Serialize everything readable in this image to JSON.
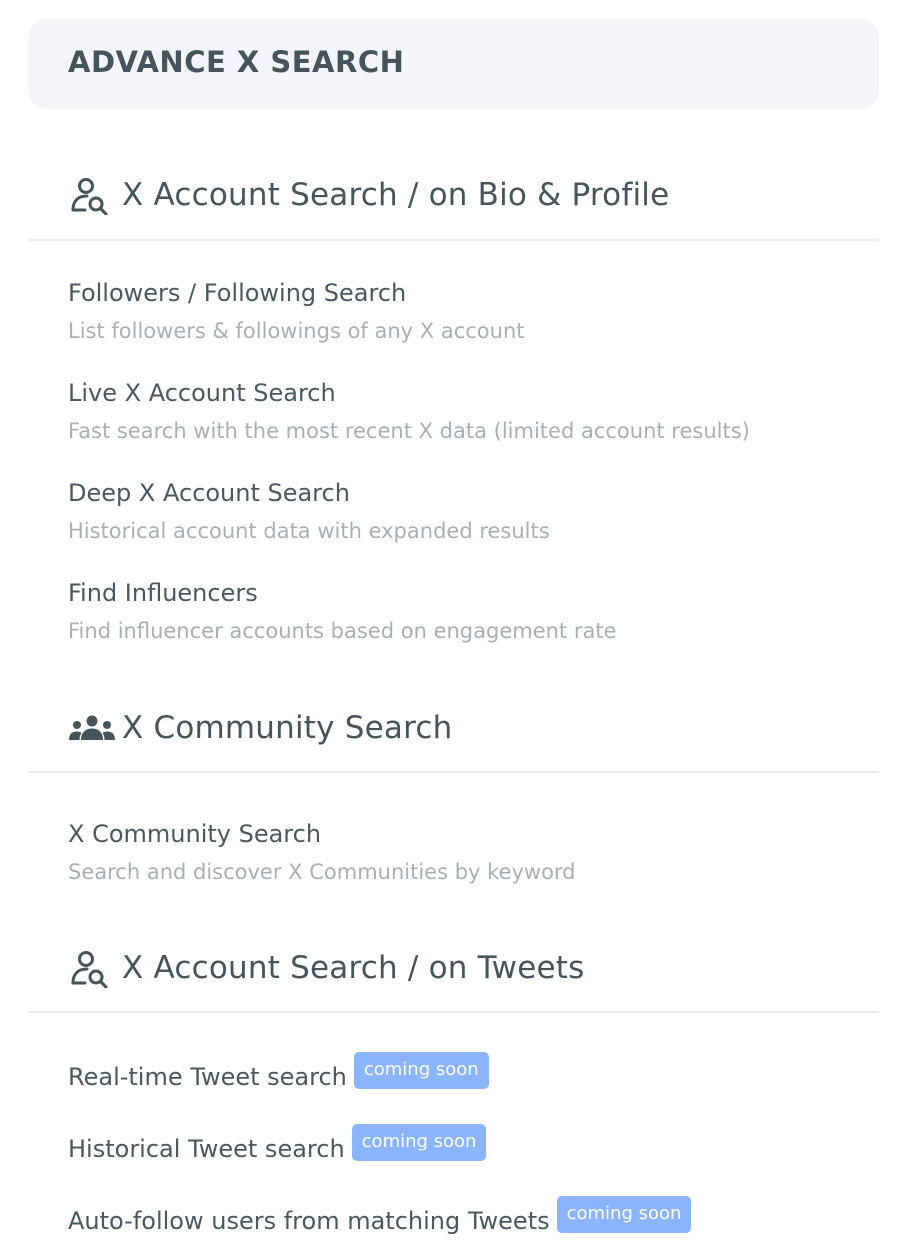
{
  "header": {
    "title": "ADVANCE X SEARCH"
  },
  "sections": [
    {
      "icon": "user-search-icon",
      "title": "X Account Search / on Bio & Profile",
      "items": [
        {
          "title": "Followers / Following Search",
          "description": "List followers & followings of any X account"
        },
        {
          "title": "Live X Account Search",
          "description": "Fast search with the most recent X data (limited account results)"
        },
        {
          "title": "Deep X Account Search",
          "description": "Historical account data with expanded results"
        },
        {
          "title": "Find Influencers",
          "description": "Find influencer accounts based on engagement rate"
        }
      ]
    },
    {
      "icon": "community-icon",
      "title": "X Community Search",
      "items": [
        {
          "title": "X Community Search",
          "description": "Search and discover X Communities by keyword"
        }
      ]
    },
    {
      "icon": "user-search-icon",
      "title": "X Account Search / on Tweets",
      "items": [
        {
          "title": "Real-time Tweet search",
          "badge": "coming soon"
        },
        {
          "title": "Historical Tweet search",
          "badge": "coming soon"
        },
        {
          "title": "Auto-follow users from matching Tweets",
          "badge": "coming soon"
        }
      ]
    }
  ],
  "colors": {
    "header_bg": "#f4f5f9",
    "text_primary": "#46555c",
    "text_secondary": "#a8b0b5",
    "badge_bg": "#8ab4fb",
    "divider": "#e8ebef"
  }
}
